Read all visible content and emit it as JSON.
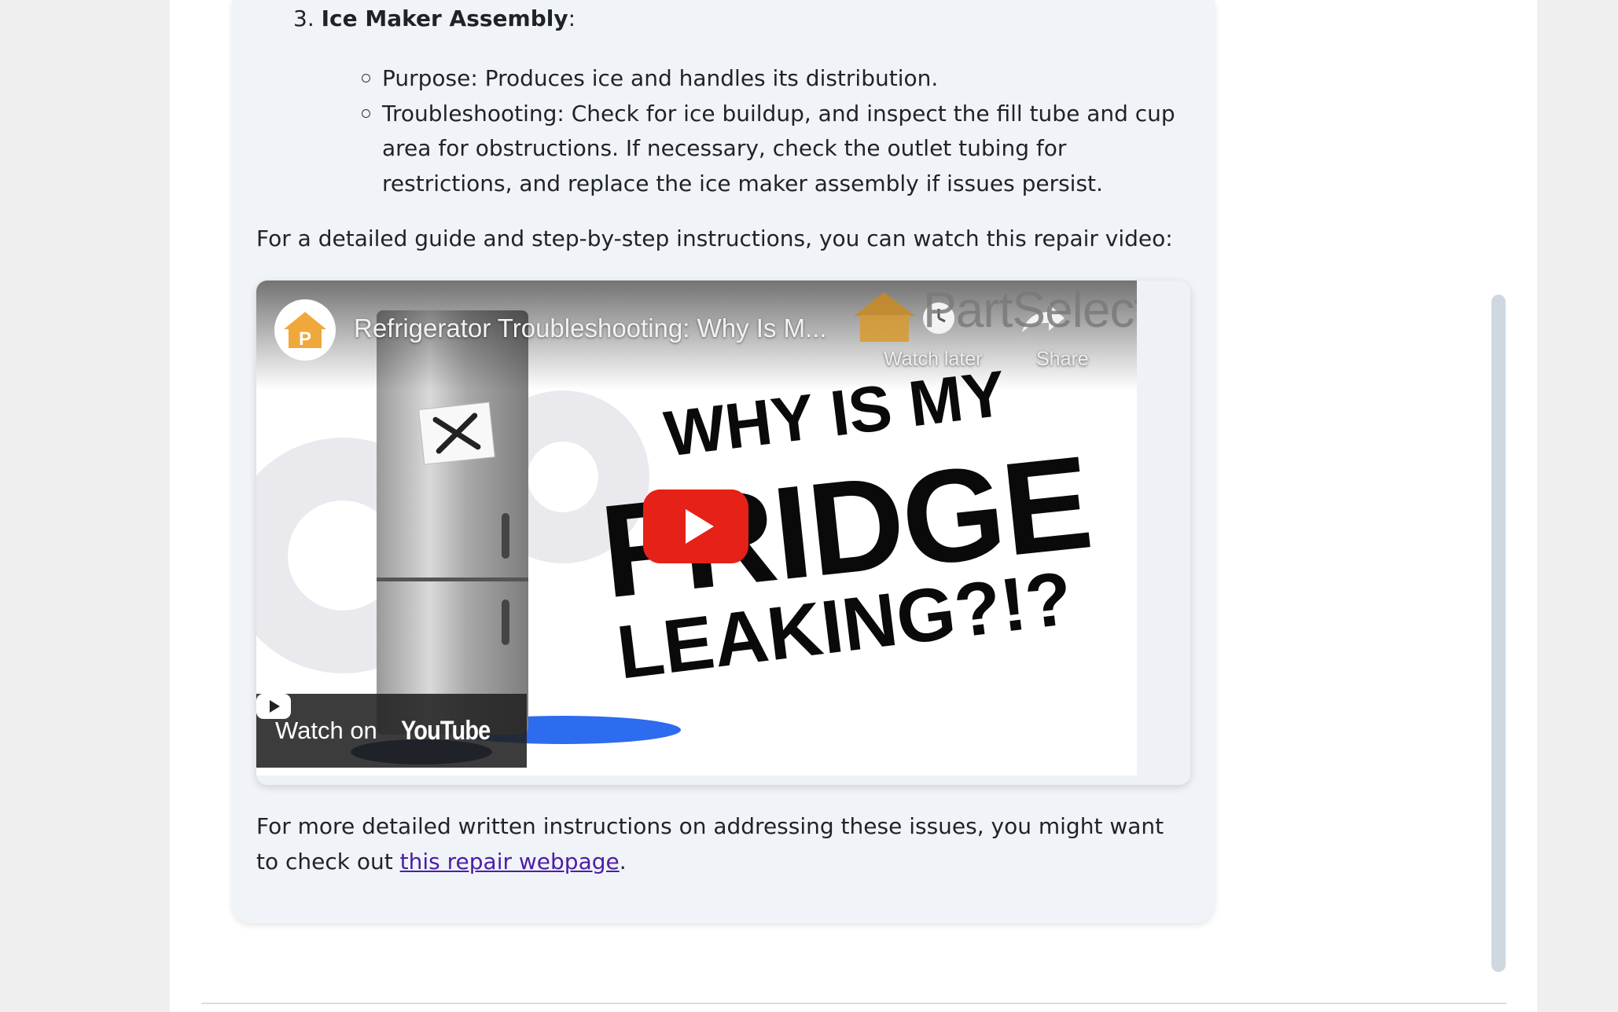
{
  "list": {
    "number": "3.",
    "title": "Ice Maker Assembly",
    "colon": ":",
    "items": [
      {
        "text": "Purpose: Produces ice and handles its distribution."
      },
      {
        "text": "Troubleshooting: Check for ice buildup, and inspect the fill tube and cup area for obstructions. If necessary, check the outlet tubing for restrictions, and replace the ice maker assembly if issues persist."
      }
    ]
  },
  "intro_text": "For a detailed guide and step-by-step instructions, you can watch this repair video:",
  "video": {
    "title": "Refrigerator Troubleshooting: Why Is M...",
    "channel_initial": "P",
    "brand_text": "PartSelect",
    "watch_later_label": "Watch later",
    "share_label": "Share",
    "headline_line1": "WHY IS MY",
    "headline_line2": "FRIDGE",
    "headline_line3": "LEAKING?!?",
    "watch_on_label": "Watch on",
    "youtube_label": "YouTube"
  },
  "followup": {
    "before_link": "For more detailed written instructions on addressing these issues, you might want to check out ",
    "link_text": "this repair webpage",
    "after_link": "."
  },
  "colors": {
    "accent_link": "#4b1ea6",
    "play_button": "#e62117",
    "brand_orange": "#f0a83a",
    "puddle_blue": "#2d6bef"
  }
}
